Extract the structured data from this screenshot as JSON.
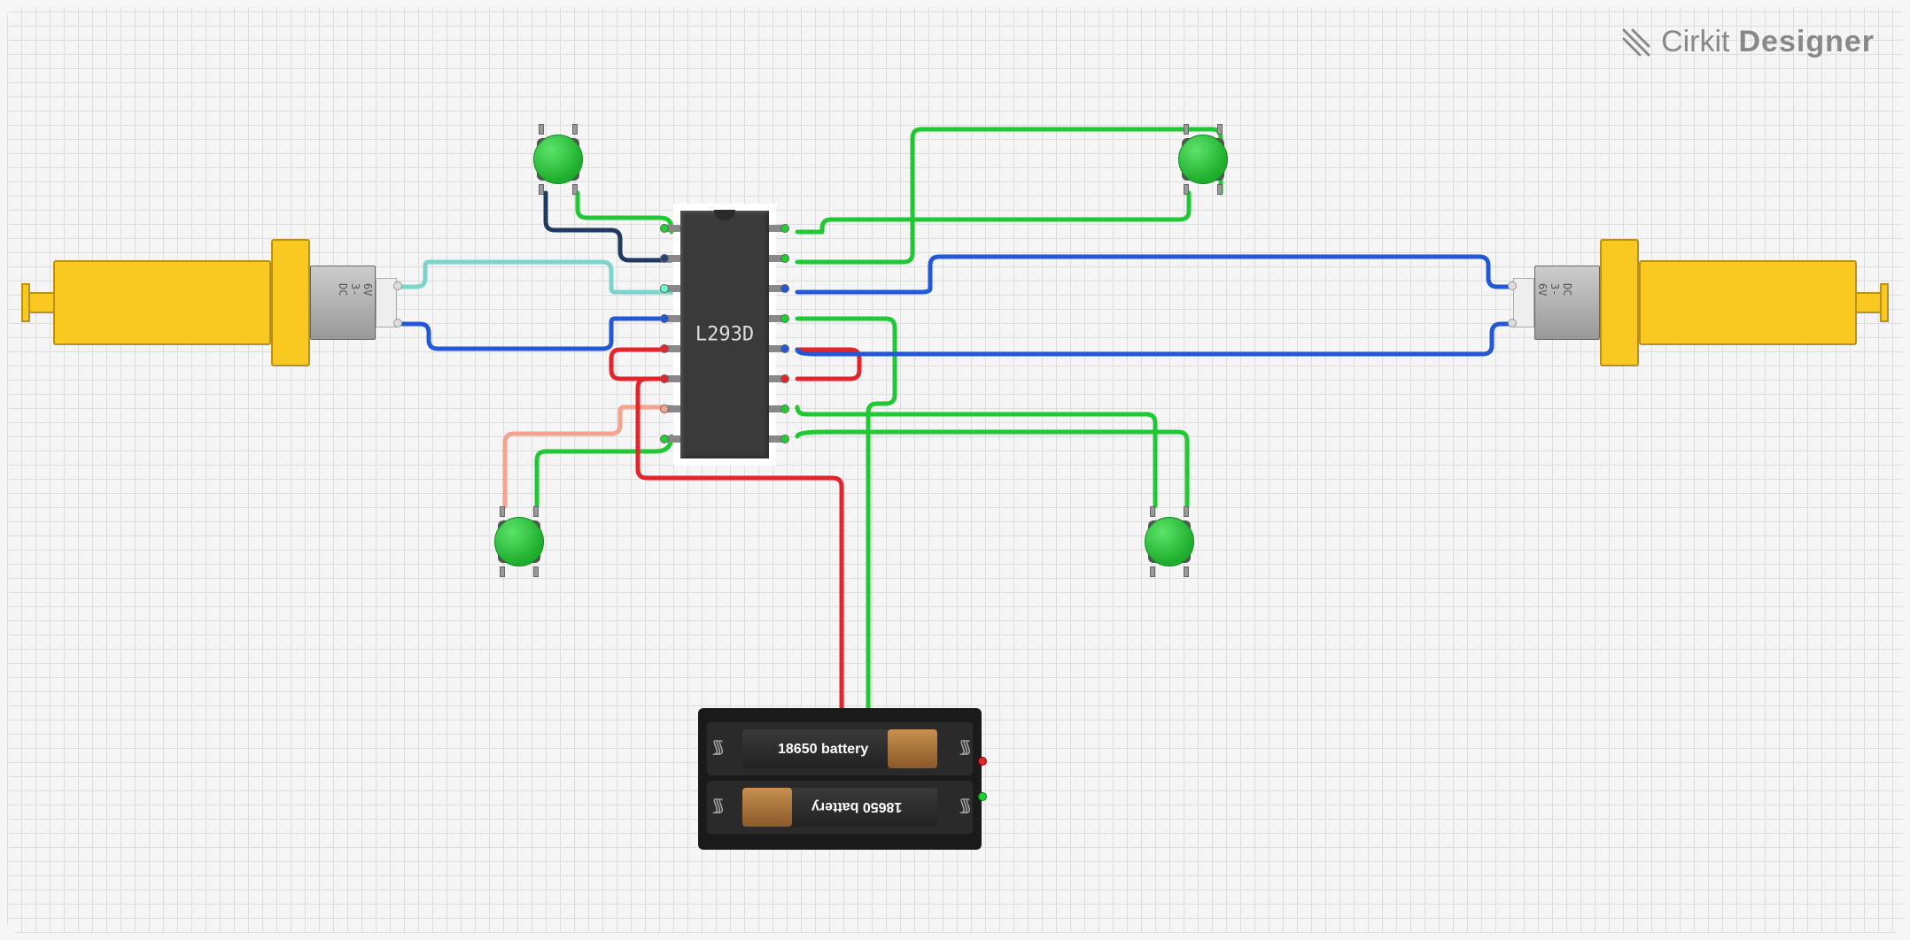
{
  "brand": {
    "name1": "Cirkit",
    "name2": "Designer"
  },
  "ic": {
    "label": "L293D",
    "pin_count": 16
  },
  "motors": {
    "left": {
      "label": "DC 3-6V"
    },
    "right": {
      "label": "DC 3-6V"
    }
  },
  "battery": {
    "cell1_label": "18650 battery",
    "cell2_label": "18650 battery"
  },
  "buttons": {
    "top_left": "pushbutton",
    "top_right": "pushbutton",
    "bottom_left": "pushbutton",
    "bottom_right": "pushbutton"
  },
  "wires": [
    {
      "name": "btn-tl-to-ic-navy",
      "color": "#2c4370",
      "from": "button_tl",
      "to": "ic.pin2"
    },
    {
      "name": "btn-tl-to-ic-green",
      "color": "#20c933",
      "from": "button_tl",
      "to": "ic.enable1"
    },
    {
      "name": "motor-l-a-to-ic",
      "color": "#7bd5cc",
      "from": "motor_left.a",
      "to": "ic.out1"
    },
    {
      "name": "motor-l-b-to-ic",
      "color": "#2257d8",
      "from": "motor_left.b",
      "to": "ic.out2"
    },
    {
      "name": "btn-bl-to-ic-salmon",
      "color": "#f5a38e",
      "from": "button_bl",
      "to": "ic.pin7"
    },
    {
      "name": "btn-bl-to-ic-green",
      "color": "#20c933",
      "from": "button_bl",
      "to": "ic.enable2"
    },
    {
      "name": "ic-vcc-red",
      "color": "#e3242b",
      "from": "ic.vcc1",
      "to": "ic.vcc2"
    },
    {
      "name": "ic-vcc-to-batt",
      "color": "#e3242b",
      "from": "ic.vcc",
      "to": "battery.pos"
    },
    {
      "name": "ic-gnd-to-batt",
      "color": "#20c933",
      "from": "ic.gnd",
      "to": "battery.neg"
    },
    {
      "name": "btn-tr-to-ic-green",
      "color": "#20c933",
      "from": "button_tr",
      "to": "ic.pin15"
    },
    {
      "name": "btn-br-to-ic-green",
      "color": "#20c933",
      "from": "button_br",
      "to": "ic.pin10"
    },
    {
      "name": "motor-r-a-to-ic",
      "color": "#2257d8",
      "from": "motor_right.a",
      "to": "ic.out3"
    },
    {
      "name": "motor-r-b-to-ic",
      "color": "#2257d8",
      "from": "motor_right.b",
      "to": "ic.out4"
    }
  ]
}
